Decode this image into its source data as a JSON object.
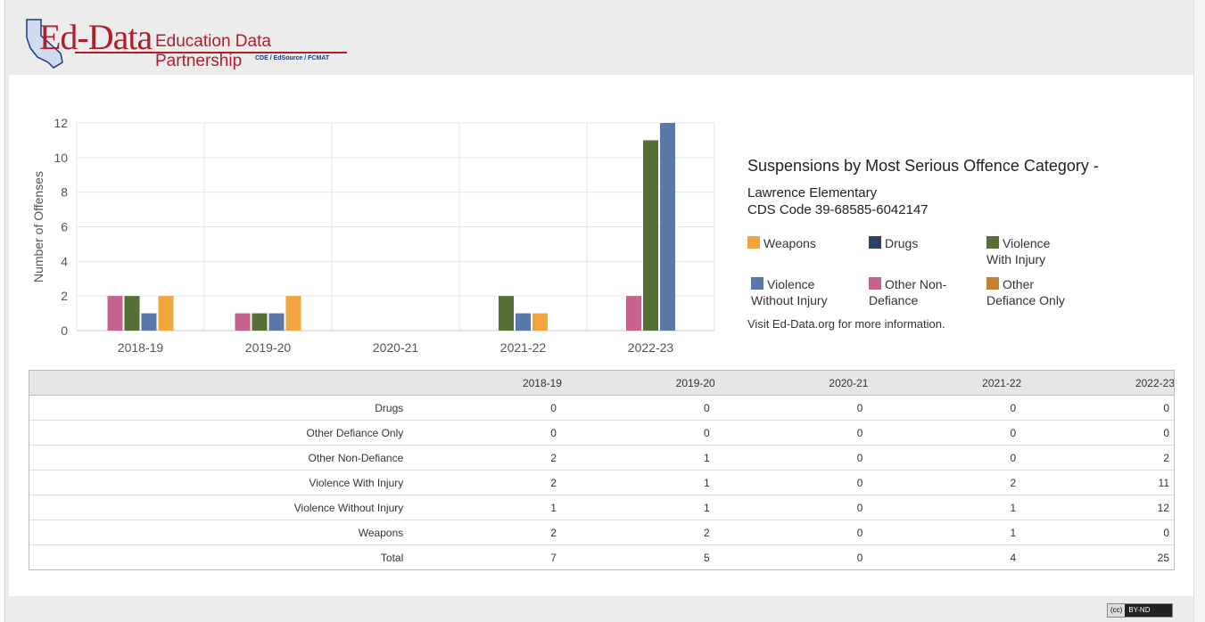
{
  "header": {
    "logo_name": "Ed-Data",
    "logo_tagline": "Education Data Partnership",
    "logo_partners": "CDE / EdSource / FCMAT",
    "brand_color": "#b01e2b"
  },
  "chart_info": {
    "title": "Suspensions by Most Serious Offence Category -",
    "school": "Lawrence Elementary",
    "cds": "CDS Code 39-68585-6042147",
    "more_info": "Visit Ed-Data.org for more information."
  },
  "legend": [
    {
      "name": "Weapons",
      "color": "#f0a63c"
    },
    {
      "name": "Drugs",
      "color": "#2f4264"
    },
    {
      "name": "Violence With Injury",
      "color": "#566f34"
    },
    {
      "name": "Violence Without Injury",
      "color": "#5b79a8"
    },
    {
      "name": "Other Non-Defiance",
      "color": "#c7628c"
    },
    {
      "name": "Other Defiance Only",
      "color": "#c58033"
    }
  ],
  "chart_data": {
    "type": "bar",
    "categories": [
      "2018-19",
      "2019-20",
      "2020-21",
      "2021-22",
      "2022-23"
    ],
    "ylabel": "Number of Offenses",
    "ylim": [
      0,
      12
    ],
    "yticks": [
      0,
      2,
      4,
      6,
      8,
      10,
      12
    ],
    "grid": true,
    "series": [
      {
        "name": "Other Non-Defiance",
        "color": "#c7628c",
        "values": [
          2,
          1,
          0,
          0,
          2
        ]
      },
      {
        "name": "Violence With Injury",
        "color": "#566f34",
        "values": [
          2,
          1,
          0,
          2,
          11
        ]
      },
      {
        "name": "Violence Without Injury",
        "color": "#5b79a8",
        "values": [
          1,
          1,
          0,
          1,
          12
        ]
      },
      {
        "name": "Weapons",
        "color": "#f0a63c",
        "values": [
          2,
          2,
          0,
          1,
          0
        ]
      },
      {
        "name": "Drugs",
        "color": "#2f4264",
        "values": [
          0,
          0,
          0,
          0,
          0
        ]
      },
      {
        "name": "Other Defiance Only",
        "color": "#c58033",
        "values": [
          0,
          0,
          0,
          0,
          0
        ]
      }
    ]
  },
  "table": {
    "columns": [
      "2018-19",
      "2019-20",
      "2020-21",
      "2021-22",
      "2022-23"
    ],
    "rows": [
      {
        "label": "Drugs",
        "values": [
          "0",
          "0",
          "0",
          "0",
          "0"
        ]
      },
      {
        "label": "Other Defiance Only",
        "values": [
          "0",
          "0",
          "0",
          "0",
          "0"
        ]
      },
      {
        "label": "Other Non-Defiance",
        "values": [
          "2",
          "1",
          "0",
          "0",
          "2"
        ]
      },
      {
        "label": "Violence With Injury",
        "values": [
          "2",
          "1",
          "0",
          "2",
          "11"
        ]
      },
      {
        "label": "Violence Without Injury",
        "values": [
          "1",
          "1",
          "0",
          "1",
          "12"
        ]
      },
      {
        "label": "Weapons",
        "values": [
          "2",
          "2",
          "0",
          "1",
          "0"
        ]
      },
      {
        "label": "Total",
        "values": [
          "7",
          "5",
          "0",
          "4",
          "25"
        ]
      }
    ]
  },
  "footer": {
    "license": "BY-ND",
    "license_prefix": "(cc)"
  }
}
